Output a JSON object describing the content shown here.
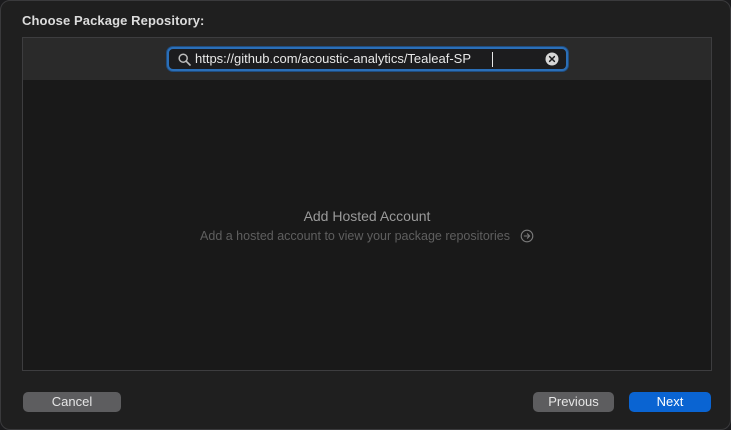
{
  "dialog": {
    "title": "Choose Package Repository:"
  },
  "search": {
    "value": "https://github.com/acoustic-analytics/Tealeaf-SP",
    "icon": "magnifying-glass",
    "clear_icon": "x-circle-fill"
  },
  "empty_state": {
    "title": "Add Hosted Account",
    "subtitle": "Add a hosted account to view your package repositories",
    "action_icon": "arrow-right-circle"
  },
  "buttons": {
    "cancel": "Cancel",
    "previous": "Previous",
    "next": "Next"
  },
  "colors": {
    "accent": "#0a64d2",
    "focus_ring": "#2b6fb8"
  }
}
